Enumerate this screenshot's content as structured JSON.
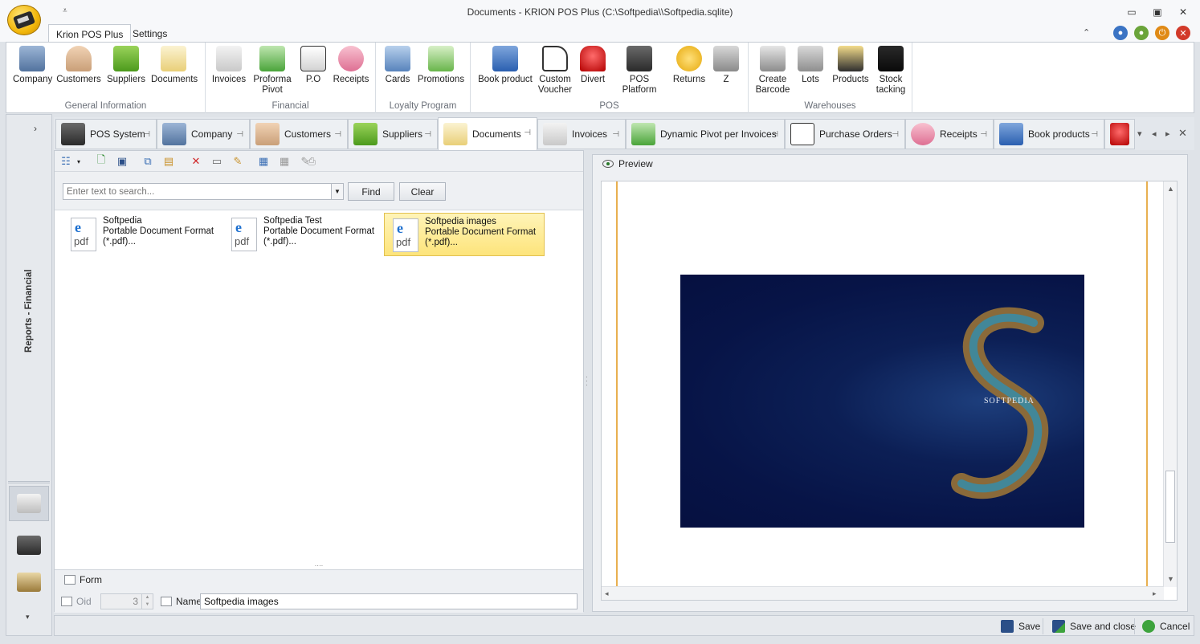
{
  "window": {
    "title": "Documents - KRION POS Plus (C:\\Softpedia\\\\Softpedia.sqlite)",
    "qat_icon": "dropdown-arrow-icon",
    "controls": {
      "minimize": "▭",
      "restore": "▣",
      "close": "✕"
    }
  },
  "ribbon_tabs": [
    "Krion POS Plus",
    "Settings"
  ],
  "ribbon": {
    "groups": [
      {
        "label": "General Information",
        "buttons": [
          "Company",
          "Customers",
          "Suppliers",
          "Documents"
        ]
      },
      {
        "label": "Financial",
        "buttons": [
          "Invoices",
          "Proforma\nPivot",
          "P.O",
          "Receipts"
        ]
      },
      {
        "label": "Loyalty Program",
        "buttons": [
          "Cards",
          "Promotions"
        ]
      },
      {
        "label": "POS",
        "buttons": [
          "Book product",
          "Custom\nVoucher",
          "Divert",
          "POS Platform",
          "Returns",
          "Z"
        ]
      },
      {
        "label": "Warehouses",
        "buttons": [
          "Create\nBarcode",
          "Lots",
          "Products",
          "Stock\ntacking"
        ]
      }
    ]
  },
  "left_panel": {
    "vertical_label": "Reports - Financial",
    "expand_icon": "›",
    "scroll_icon": "▾"
  },
  "doc_tabs": [
    "POS System",
    "Company",
    "Customers",
    "Suppliers",
    "Documents",
    "Invoices",
    "Dynamic Pivot per Invoices",
    "Purchase Orders",
    "Receipts",
    "Book products"
  ],
  "documents": {
    "search_placeholder": "Enter text to search...",
    "find_label": "Find",
    "clear_label": "Clear",
    "items": [
      {
        "title": "Softpedia",
        "type": "Portable Document Format",
        "ext": "(*.pdf)..."
      },
      {
        "title": "Softpedia Test",
        "type": "Portable Document Format",
        "ext": "(*.pdf)..."
      },
      {
        "title": "Softpedia images",
        "type": "Portable Document Format",
        "ext": "(*.pdf)..."
      }
    ],
    "icon_letter": "e",
    "icon_text": "pdf"
  },
  "form": {
    "title": "Form",
    "oid_label": "Oid",
    "oid_value": "3",
    "name_label": "Name",
    "name_value": "Softpedia images"
  },
  "preview": {
    "title": "Preview",
    "image_text": "SOFTPEDIA"
  },
  "bottom": {
    "save": "Save",
    "save_close": "Save and close",
    "cancel": "Cancel"
  },
  "colors": {
    "accent": "#f2b70c",
    "selection": "#fde47b",
    "preview_bg": "#071447"
  }
}
